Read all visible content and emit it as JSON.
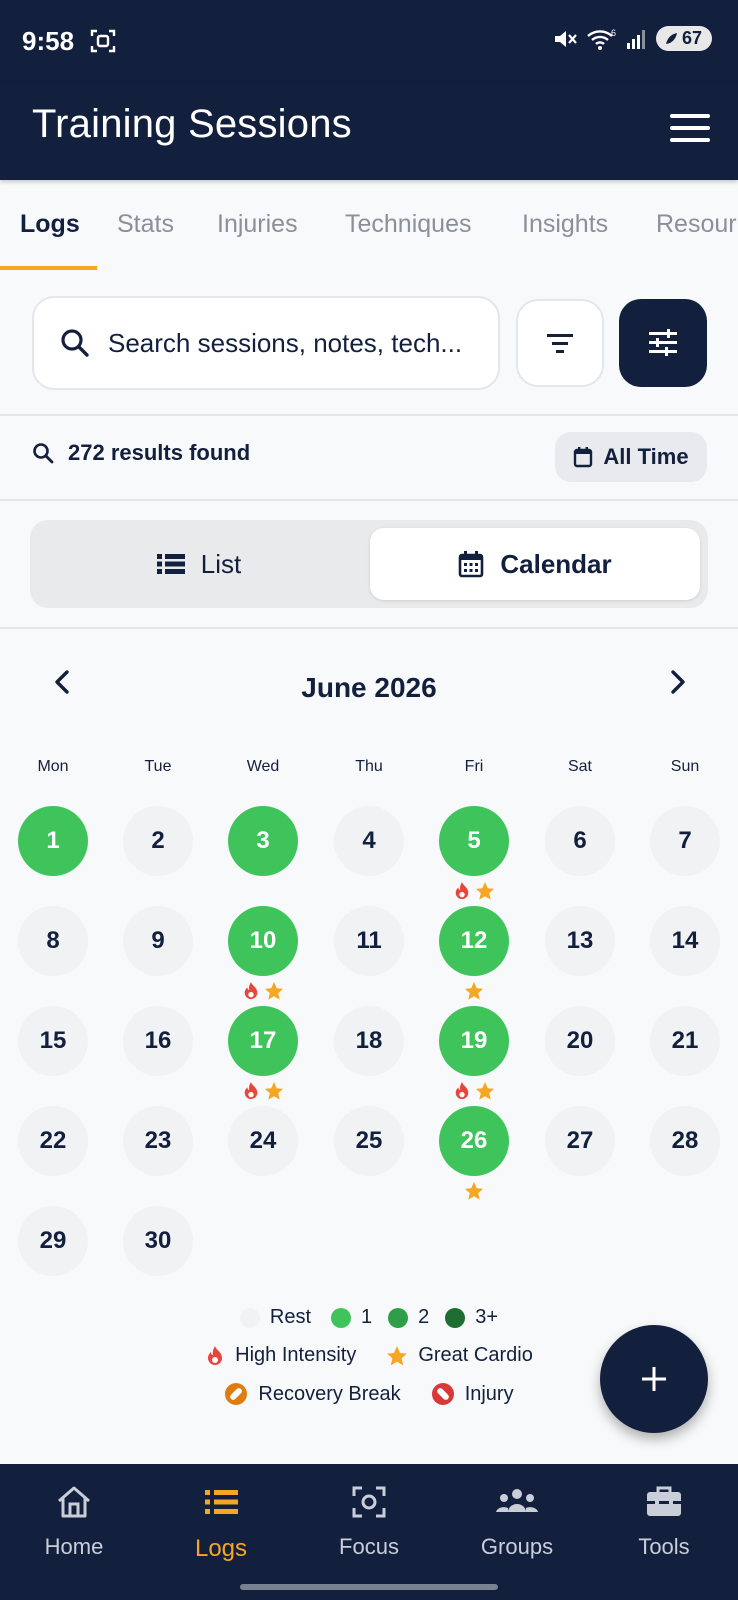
{
  "status": {
    "time": "9:58",
    "battery": "67",
    "wifi_badge": "6"
  },
  "app": {
    "title": "Training Sessions"
  },
  "tabs": [
    {
      "label": "Logs",
      "active": true
    },
    {
      "label": "Stats"
    },
    {
      "label": "Injuries"
    },
    {
      "label": "Techniques"
    },
    {
      "label": "Insights"
    },
    {
      "label": "Resour"
    }
  ],
  "search": {
    "placeholder": "Search sessions, notes, tech..."
  },
  "results": {
    "text": "272 results found",
    "time_filter": "All Time"
  },
  "view": {
    "list_label": "List",
    "calendar_label": "Calendar",
    "selected": "Calendar"
  },
  "calendar": {
    "month": "June 2026",
    "weekdays": [
      "Mon",
      "Tue",
      "Wed",
      "Thu",
      "Fri",
      "Sat",
      "Sun"
    ],
    "days": [
      {
        "d": "1",
        "active": true
      },
      {
        "d": "2"
      },
      {
        "d": "3",
        "active": true
      },
      {
        "d": "4"
      },
      {
        "d": "5",
        "active": true,
        "marks": [
          "fire",
          "star"
        ]
      },
      {
        "d": "6"
      },
      {
        "d": "7"
      },
      {
        "d": "8"
      },
      {
        "d": "9"
      },
      {
        "d": "10",
        "active": true,
        "marks": [
          "fire",
          "star"
        ]
      },
      {
        "d": "11"
      },
      {
        "d": "12",
        "active": true,
        "marks": [
          "star"
        ]
      },
      {
        "d": "13"
      },
      {
        "d": "14"
      },
      {
        "d": "15"
      },
      {
        "d": "16"
      },
      {
        "d": "17",
        "active": true,
        "marks": [
          "fire",
          "star"
        ]
      },
      {
        "d": "18"
      },
      {
        "d": "19",
        "active": true,
        "marks": [
          "fire",
          "star"
        ]
      },
      {
        "d": "20"
      },
      {
        "d": "21"
      },
      {
        "d": "22"
      },
      {
        "d": "23"
      },
      {
        "d": "24"
      },
      {
        "d": "25"
      },
      {
        "d": "26",
        "active": true,
        "marks": [
          "star"
        ]
      },
      {
        "d": "27"
      },
      {
        "d": "28"
      },
      {
        "d": "29"
      },
      {
        "d": "30"
      }
    ]
  },
  "legend": {
    "rest": "Rest",
    "one": "1",
    "two": "2",
    "three_plus": "3+",
    "high_intensity": "High Intensity",
    "great_cardio": "Great Cardio",
    "recovery_break": "Recovery Break",
    "injury": "Injury",
    "colors": {
      "rest": "#f1f2f3",
      "one": "#3fc45c",
      "two": "#2e9e48",
      "three_plus": "#1f6d32"
    }
  },
  "bottom_nav": [
    {
      "label": "Home",
      "icon": "home-icon"
    },
    {
      "label": "Logs",
      "icon": "list-icon",
      "active": true
    },
    {
      "label": "Focus",
      "icon": "focus-icon"
    },
    {
      "label": "Groups",
      "icon": "groups-icon"
    },
    {
      "label": "Tools",
      "icon": "toolbox-icon"
    }
  ],
  "colors": {
    "primary": "#13203d",
    "accent": "#f5a623",
    "active_day": "#3fc45c"
  }
}
